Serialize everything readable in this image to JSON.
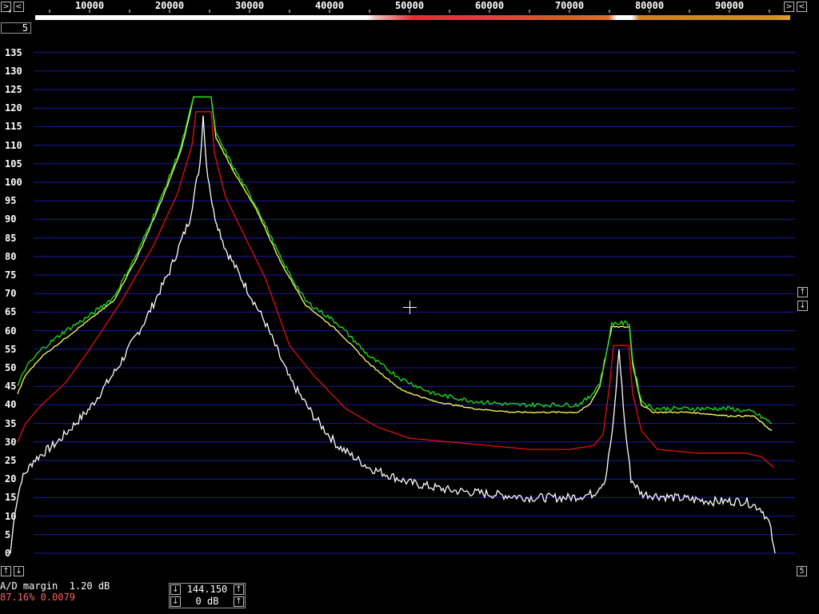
{
  "x_axis": {
    "ticks": [
      "10000",
      "20000",
      "30000",
      "40000",
      "50000",
      "60000",
      "70000",
      "80000",
      "90000"
    ]
  },
  "y_axis": {
    "ticks": [
      "135",
      "130",
      "125",
      "120",
      "115",
      "110",
      "105",
      "100",
      "95",
      "90",
      "85",
      "80",
      "75",
      "70",
      "65",
      "60",
      "55",
      "50",
      "45",
      "40",
      "35",
      "30",
      "25",
      "20",
      "15",
      "10",
      "5",
      "0"
    ]
  },
  "controls": {
    "scale_box": "5",
    "bottom_right_box": "5",
    "arrow_right": ">",
    "arrow_left": "<",
    "arrow_up": "↑",
    "arrow_down": "↓"
  },
  "status": {
    "ad_margin": "A/D margin  1.20 dB",
    "cpu": "87.16% 0.0079",
    "frequency": "144.150",
    "gain": "0 dB"
  },
  "colors": {
    "background": "#000000",
    "grid": "#1a1aa0",
    "white_trace": "#ffffff",
    "red_trace": "#e01010",
    "yellow_trace": "#ffff60",
    "green_trace": "#20e020",
    "cpu_text": "#ff6060"
  },
  "chart_data": {
    "type": "line",
    "x_range": [
      0,
      96000
    ],
    "ylim": [
      0,
      137
    ],
    "grid": "horizontal",
    "series": [
      {
        "color": "white",
        "points": [
          [
            100,
            0
          ],
          [
            700,
            12
          ],
          [
            1500,
            20
          ],
          [
            3000,
            25
          ],
          [
            6000,
            30
          ],
          [
            10000,
            39
          ],
          [
            13500,
            50
          ],
          [
            17000,
            63
          ],
          [
            20000,
            76
          ],
          [
            22500,
            90
          ],
          [
            23800,
            105
          ],
          [
            24200,
            118
          ],
          [
            24600,
            105
          ],
          [
            25500,
            92
          ],
          [
            27000,
            82
          ],
          [
            29500,
            72
          ],
          [
            32000,
            62
          ],
          [
            35000,
            47
          ],
          [
            38000,
            37
          ],
          [
            41000,
            29
          ],
          [
            45000,
            23
          ],
          [
            50000,
            19
          ],
          [
            55000,
            17
          ],
          [
            60000,
            16
          ],
          [
            65000,
            15
          ],
          [
            70000,
            15
          ],
          [
            73000,
            16
          ],
          [
            74500,
            20
          ],
          [
            75500,
            35
          ],
          [
            76200,
            55
          ],
          [
            76900,
            35
          ],
          [
            77700,
            20
          ],
          [
            79000,
            16
          ],
          [
            83000,
            15
          ],
          [
            88000,
            14
          ],
          [
            92000,
            14
          ],
          [
            94000,
            12
          ],
          [
            95000,
            8
          ],
          [
            95700,
            0
          ]
        ]
      },
      {
        "color": "red",
        "points": [
          [
            1000,
            30
          ],
          [
            2000,
            35
          ],
          [
            4000,
            40
          ],
          [
            7000,
            46
          ],
          [
            10000,
            55
          ],
          [
            14000,
            68
          ],
          [
            18000,
            83
          ],
          [
            21000,
            97
          ],
          [
            22800,
            110
          ],
          [
            23300,
            119
          ],
          [
            25200,
            119
          ],
          [
            25600,
            108
          ],
          [
            27000,
            96
          ],
          [
            29500,
            85
          ],
          [
            32000,
            74
          ],
          [
            35000,
            56
          ],
          [
            38000,
            48
          ],
          [
            42000,
            39
          ],
          [
            46000,
            34
          ],
          [
            50000,
            31
          ],
          [
            55000,
            30
          ],
          [
            60000,
            29
          ],
          [
            65000,
            28
          ],
          [
            70000,
            28
          ],
          [
            73000,
            29
          ],
          [
            74200,
            32
          ],
          [
            75000,
            45
          ],
          [
            75500,
            56
          ],
          [
            77400,
            56
          ],
          [
            77900,
            43
          ],
          [
            79000,
            33
          ],
          [
            81000,
            28
          ],
          [
            86000,
            27
          ],
          [
            92000,
            27
          ],
          [
            94000,
            26
          ],
          [
            95600,
            23
          ]
        ]
      },
      {
        "color": "yellow",
        "points": [
          [
            1000,
            43
          ],
          [
            2000,
            48
          ],
          [
            4000,
            53
          ],
          [
            7000,
            58
          ],
          [
            10000,
            63
          ],
          [
            13000,
            68
          ],
          [
            16000,
            80
          ],
          [
            19000,
            95
          ],
          [
            21500,
            109
          ],
          [
            22500,
            118
          ],
          [
            23000,
            123
          ],
          [
            25200,
            123
          ],
          [
            25800,
            112
          ],
          [
            28000,
            103
          ],
          [
            31000,
            92
          ],
          [
            34000,
            78
          ],
          [
            37000,
            67
          ],
          [
            41000,
            60
          ],
          [
            45000,
            51
          ],
          [
            49000,
            44
          ],
          [
            53000,
            41
          ],
          [
            58000,
            39
          ],
          [
            63000,
            38
          ],
          [
            68000,
            38
          ],
          [
            71000,
            38
          ],
          [
            72500,
            40
          ],
          [
            73800,
            45
          ],
          [
            74700,
            55
          ],
          [
            75300,
            61
          ],
          [
            77500,
            61
          ],
          [
            77900,
            51
          ],
          [
            79000,
            40
          ],
          [
            80500,
            38
          ],
          [
            85000,
            38
          ],
          [
            90000,
            37
          ],
          [
            93000,
            37
          ],
          [
            95300,
            33
          ]
        ]
      },
      {
        "color": "green",
        "points": [
          [
            1000,
            45
          ],
          [
            2000,
            50
          ],
          [
            4000,
            55
          ],
          [
            7000,
            60
          ],
          [
            10000,
            64
          ],
          [
            13000,
            69
          ],
          [
            16000,
            81
          ],
          [
            19000,
            96
          ],
          [
            21500,
            110
          ],
          [
            22500,
            119
          ],
          [
            23000,
            123
          ],
          [
            25200,
            123
          ],
          [
            25800,
            113
          ],
          [
            28000,
            104
          ],
          [
            31000,
            93
          ],
          [
            34000,
            79
          ],
          [
            37000,
            68
          ],
          [
            41000,
            62
          ],
          [
            45000,
            53
          ],
          [
            49000,
            47
          ],
          [
            53000,
            43
          ],
          [
            58000,
            41
          ],
          [
            63000,
            40
          ],
          [
            68000,
            40
          ],
          [
            71000,
            40
          ],
          [
            72500,
            42
          ],
          [
            73800,
            46
          ],
          [
            74700,
            55
          ],
          [
            75300,
            62
          ],
          [
            77500,
            62
          ],
          [
            77900,
            52
          ],
          [
            79000,
            41
          ],
          [
            80500,
            39
          ],
          [
            85000,
            39
          ],
          [
            90000,
            39
          ],
          [
            93000,
            38
          ],
          [
            95300,
            35
          ]
        ]
      }
    ]
  }
}
